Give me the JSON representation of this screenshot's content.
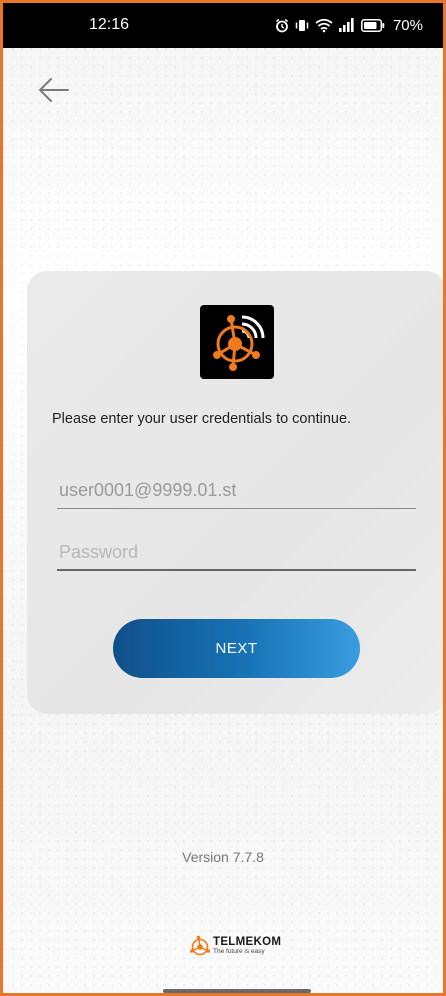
{
  "status_bar": {
    "time": "12:16",
    "icons": [
      "alarm-icon",
      "vibrate-icon",
      "wifi-icon",
      "signal-icon",
      "battery-icon"
    ],
    "battery": "70%"
  },
  "nav": {
    "back_icon": "arrow-left-icon"
  },
  "login": {
    "prompt": "Please enter your user credentials to continue.",
    "username_value": "user0001@9999.01.st",
    "password_placeholder": "Password",
    "next_label": "NEXT"
  },
  "footer": {
    "version": "Version 7.7.8",
    "brand_name": "TELMEKOM",
    "brand_tagline": "The future is easy"
  },
  "colors": {
    "accent": "#e8762b",
    "button_start": "#10508a",
    "button_end": "#3a9ce0"
  }
}
